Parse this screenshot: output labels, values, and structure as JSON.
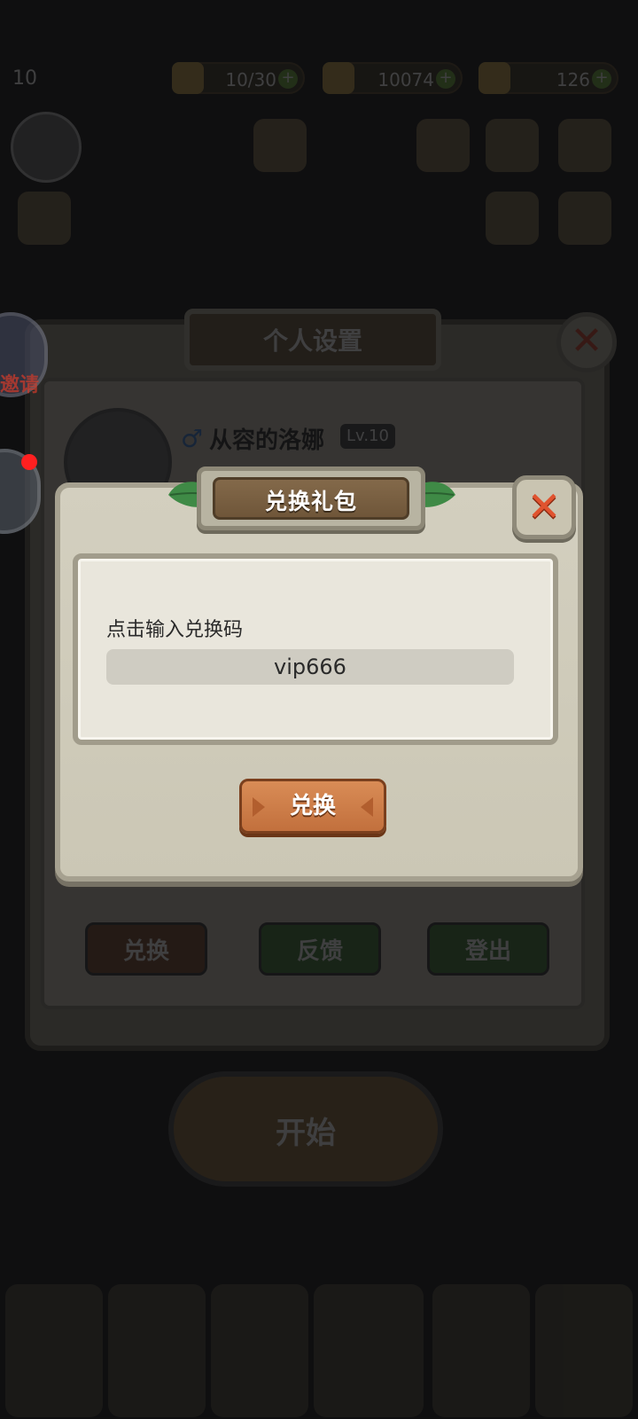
{
  "background": {
    "level_short": "10",
    "resources": [
      {
        "icon": "stamina-icon",
        "value": "10/30"
      },
      {
        "icon": "gold-icon",
        "value": "10074"
      },
      {
        "icon": "gem-icon",
        "value": "126"
      }
    ],
    "panel_title": "个人设置",
    "user_name": "从容的洛娜",
    "user_level": "Lv.10",
    "buttons": [
      "兑换",
      "反馈",
      "登出"
    ],
    "start_label": "开始",
    "invite_label": "邀请"
  },
  "dialog": {
    "title": "兑换礼包",
    "close_symbol": "✕",
    "prompt": "点击输入兑换码",
    "code_value": "vip666",
    "redeem_label": "兑换"
  },
  "colors": {
    "accent_orange": "#c2703d",
    "close_red": "#e0532f",
    "title_brown": "#6f5639",
    "stone": "#cbc7b5"
  }
}
